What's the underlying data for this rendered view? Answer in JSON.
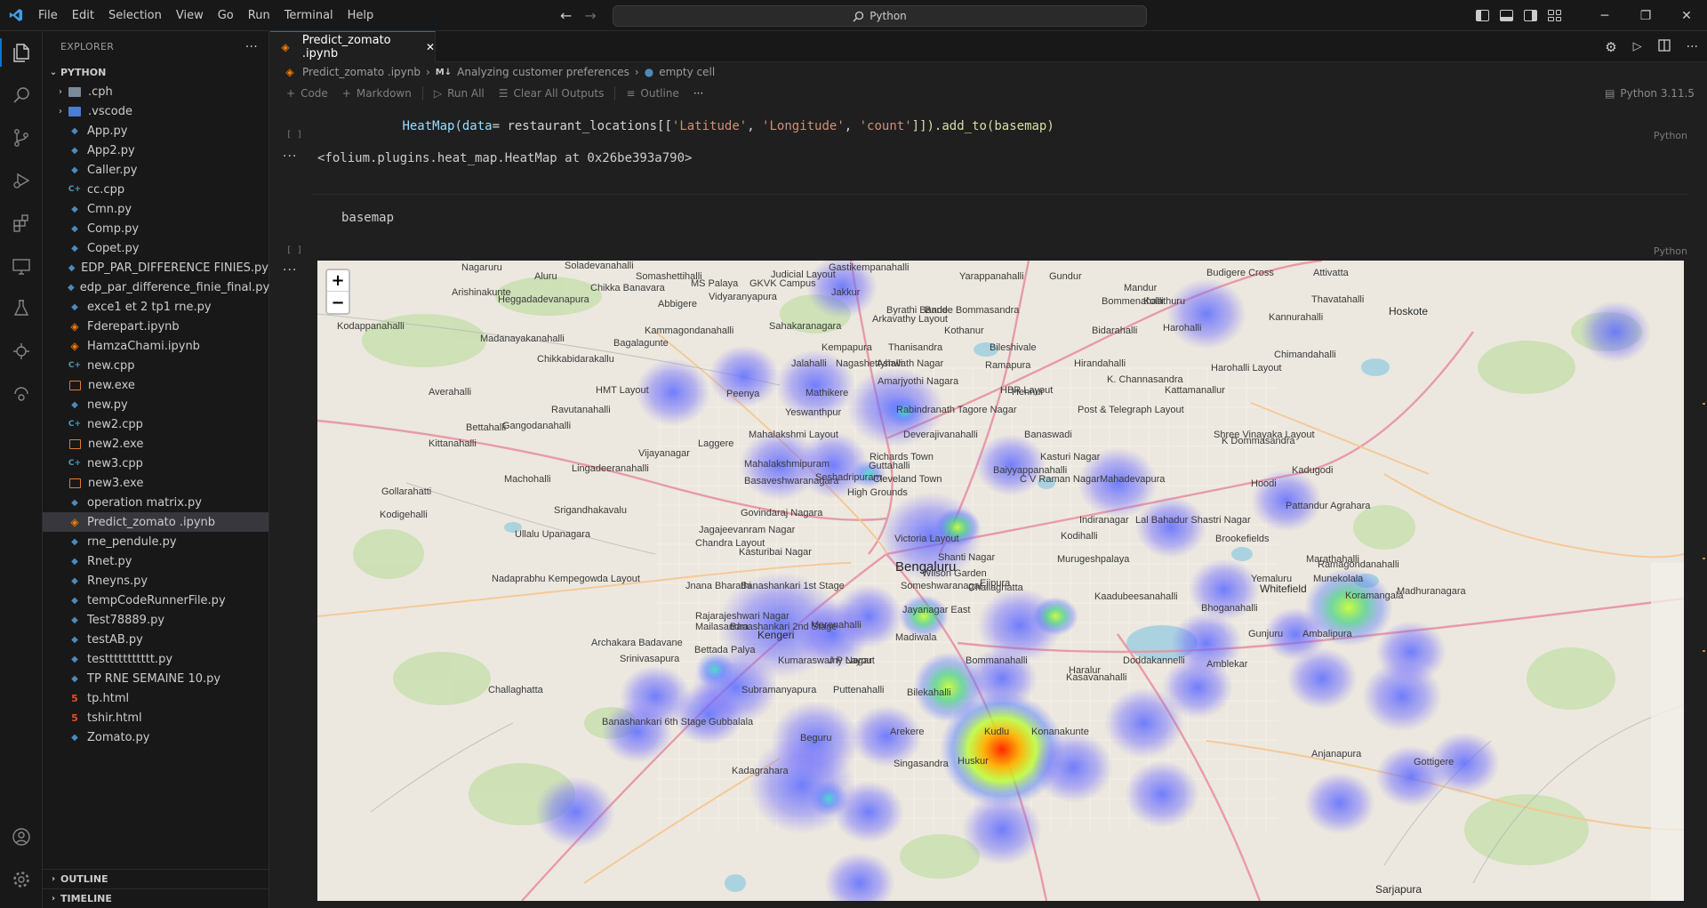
{
  "titlebar": {
    "menu": [
      "File",
      "Edit",
      "Selection",
      "View",
      "Go",
      "Run",
      "Terminal",
      "Help"
    ],
    "search": "Python"
  },
  "sidebar": {
    "title": "EXPLORER",
    "folder": "PYTHON",
    "items": [
      {
        "name": ".cph",
        "kind": "folder"
      },
      {
        "name": ".vscode",
        "kind": "folder-blue"
      },
      {
        "name": "App.py",
        "kind": "py"
      },
      {
        "name": "App2.py",
        "kind": "py"
      },
      {
        "name": "Caller.py",
        "kind": "py"
      },
      {
        "name": "cc.cpp",
        "kind": "cpp"
      },
      {
        "name": "Cmn.py",
        "kind": "py"
      },
      {
        "name": "Comp.py",
        "kind": "py"
      },
      {
        "name": "Copet.py",
        "kind": "py"
      },
      {
        "name": "EDP_PAR_DIFFERENCE FINIES.py",
        "kind": "py"
      },
      {
        "name": "edp_par_difference_finie_final.py",
        "kind": "py"
      },
      {
        "name": "exce1 et 2 tp1 rne.py",
        "kind": "py"
      },
      {
        "name": "Fderepart.ipynb",
        "kind": "ipynb"
      },
      {
        "name": "HamzaChami.ipynb",
        "kind": "ipynb"
      },
      {
        "name": "new.cpp",
        "kind": "cpp"
      },
      {
        "name": "new.exe",
        "kind": "exe"
      },
      {
        "name": "new.py",
        "kind": "py"
      },
      {
        "name": "new2.cpp",
        "kind": "cpp"
      },
      {
        "name": "new2.exe",
        "kind": "exe"
      },
      {
        "name": "new3.cpp",
        "kind": "cpp"
      },
      {
        "name": "new3.exe",
        "kind": "exe"
      },
      {
        "name": "operation matrix.py",
        "kind": "py"
      },
      {
        "name": "Predict_zomato .ipynb",
        "kind": "ipynb",
        "active": true
      },
      {
        "name": "rne_pendule.py",
        "kind": "py"
      },
      {
        "name": "Rnet.py",
        "kind": "py"
      },
      {
        "name": "Rneyns.py",
        "kind": "py"
      },
      {
        "name": "tempCodeRunnerFile.py",
        "kind": "py"
      },
      {
        "name": "Test78889.py",
        "kind": "py"
      },
      {
        "name": "testAB.py",
        "kind": "py"
      },
      {
        "name": "testtttttttttt.py",
        "kind": "py"
      },
      {
        "name": "TP RNE SEMAINE 10.py",
        "kind": "py"
      },
      {
        "name": "tp.html",
        "kind": "html"
      },
      {
        "name": "tshir.html",
        "kind": "html"
      },
      {
        "name": "Zomato.py",
        "kind": "py"
      }
    ],
    "outline": "OUTLINE",
    "timeline": "TIMELINE"
  },
  "editor": {
    "tab_label": "Predict_zomato .ipynb",
    "breadcrumb": {
      "file": "Predict_zomato .ipynb",
      "section_prefix": "M↓",
      "section": "Analyzing customer preferences",
      "cell": "empty cell"
    },
    "toolbar": {
      "code": "Code",
      "markdown": "Markdown",
      "run_all": "Run All",
      "clear": "Clear All Outputs",
      "outline": "Outline",
      "more": "···",
      "kernel": "Python 3.11.5"
    },
    "cells": {
      "prev_code": "HeatMap(data= restaurant_locations[['Latitude','Longitude','count']]).add_to(basemap)",
      "prev_code_parts": [
        "HeatMap(",
        "data",
        "= restaurant_locations[[",
        "'Latitude'",
        ", ",
        "'Longitude'",
        ", ",
        "'count'",
        "]]).add_to(basemap)"
      ],
      "exec_empty": "[ ]",
      "lang": "Python",
      "output_text": "<folium.plugins.heat_map.HeatMap at 0x26be393a790>",
      "basemap_code": "basemap",
      "lang2": "Python"
    }
  },
  "map": {
    "zoom_in": "+",
    "zoom_out": "−",
    "city": "Bengaluru",
    "labels": [
      "Soladevanahalli",
      "Somashettihalli",
      "Judicial Layout",
      "Gastikempanahalli",
      "Nagaruru",
      "Aluru",
      "Chikka Banavara",
      "MS Palaya",
      "GKVK Campus",
      "Jakkur",
      "Yarappanahalli",
      "Gundur",
      "Mandur",
      "Budigere Cross",
      "Attivatta",
      "Arishinakunte",
      "Heggadadevanapura",
      "Abbigere",
      "Vidyaranyapura",
      "Byrathi Bande",
      "Bande Bommasandra",
      "Bommenahalli",
      "Hoskote",
      "Thavatahalli",
      "Kodappanahalli",
      "Kammagondanahalli",
      "Sahakaranagara",
      "Arkavathy Layout",
      "Kothanur",
      "Bidarahalli",
      "Kolathuru",
      "Madanayakanahalli",
      "Bagalagunte",
      "Kempapura",
      "Thanisandra",
      "Bileshivale",
      "Harohalli",
      "Kannurahalli",
      "Harohalli Layout",
      "Chikkabidarakallu",
      "Jalahalli",
      "Nagashettyhalli",
      "Amarjyothi Nagara",
      "Ashwath Nagar",
      "Ramapura",
      "Hirandahalli",
      "Kattamanallur",
      "Chimandahalli",
      "HMT Layout",
      "Peenya",
      "Mathikere",
      "HBR Layout",
      "K. Channasandra",
      "Averahalli",
      "Ravutanahalli",
      "Yeswanthpur",
      "Rabindranath Tagore Nagar",
      "Hennur",
      "Post & Telegraph Layout",
      "Gangodanahalli",
      "Deverajivanahalli",
      "Banaswadi",
      "Bettahalli",
      "Mahalakshmi Layout",
      "Kittanahalli",
      "Laggere",
      "Richards Town",
      "Shree Vinayaka Layout",
      "K Dommasandra",
      "Vijayanagar",
      "Guttahalli",
      "Kasturi Nagar",
      "Mahalakshmipuram",
      "Machohalli",
      "Lingadeeranahalli",
      "Seshadripuram",
      "Cleveland Town",
      "Baiyyappanahalli",
      "Mahadevapura",
      "Basaveshwaranagara",
      "High Grounds",
      "C V Raman Nagar",
      "Hoodi",
      "Kadugodi",
      "Gollarahatti",
      "Srigandhakavalu",
      "Govindaraj Nagara",
      "Bengaluru",
      "Pattandur Agrahara",
      "Kodigehalli",
      "Indiranagar",
      "Lal Bahadur Shastri Nagar",
      "Whitefield",
      "Jagajeevanram Nagar",
      "Victoria Layout",
      "Kodihalli",
      "Brookefields",
      "Ullalu Upanagara",
      "Chandra Layout",
      "Shanti Nagar",
      "Murugeshpalaya",
      "Marathahalli",
      "Ramagondanahalli",
      "Kasturibai Nagar",
      "Wilson Garden",
      "Nadaprabhu Kempegowda Layout",
      "Jnana Bharathi",
      "Banashankari 1st Stage",
      "Someshwaranagar",
      "Ejipura",
      "Challaghatta",
      "Yemaluru",
      "Munekolala",
      "Koramangala",
      "Kaadubeesanahalli",
      "Madhuranagara",
      "Rajarajeshwari Nagar",
      "Jayanagar East",
      "Banashankari 2nd Stage",
      "Marenahalli",
      "Bhoganahalli",
      "Kengeri",
      "Mailasandra",
      "Madiwala",
      "Ambalipura",
      "Gunjuru",
      "Archakara Badavane",
      "Bettada Palya",
      "Srinivasapura",
      "J P Nagar",
      "Bommanahalli",
      "Doddakannelli",
      "Kumaraswamy Layout",
      "Haralur",
      "Amblekar",
      "Challaghatta",
      "Subramanyapura",
      "Puttenahalli",
      "Bilekahalli",
      "Kasavanahalli",
      "Banashankari 6th Stage",
      "Gubbalala",
      "Arekere",
      "Kudlu",
      "Konanakunte",
      "Singasandra",
      "Beguru",
      "Huskur",
      "Sarjapura",
      "Anjanapura",
      "Gottigere",
      "Kadagrahara"
    ]
  },
  "colors": {
    "accent": "#0078d4",
    "editor_bg": "#1f1f1f",
    "sidebar_bg": "#181818"
  }
}
